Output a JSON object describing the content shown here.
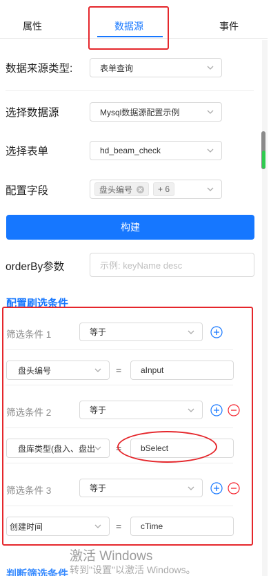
{
  "tabs": [
    {
      "label": "属性"
    },
    {
      "label": "数据源"
    },
    {
      "label": "事件"
    }
  ],
  "form": {
    "data_source_type": {
      "label": "数据来源类型:",
      "value": "表单查询"
    },
    "select_data_source": {
      "label": "选择数据源",
      "value": "Mysql数据源配置示例"
    },
    "select_form": {
      "label": "选择表单",
      "value": "hd_beam_check"
    },
    "config_fields": {
      "label": "配置字段",
      "tag": "盘头编号",
      "more": "+ 6"
    },
    "build_button": "构建",
    "order_by": {
      "label": "orderBy参数",
      "placeholder": "示例: keyName desc"
    }
  },
  "filter": {
    "title": "配置刷选条件",
    "conditions": [
      {
        "label": "筛选条件 1",
        "operator": "等于",
        "field": "盘头编号",
        "value": "aInput",
        "eq": "="
      },
      {
        "label": "筛选条件 2",
        "operator": "等于",
        "field": "盘库类型(盘入、盘出",
        "value": "bSelect",
        "eq": "="
      },
      {
        "label": "筛选条件 3",
        "operator": "等于",
        "field": "创建时间",
        "value": "cTime",
        "eq": "="
      }
    ]
  },
  "watermark": {
    "line1": "激活 Windows",
    "line2": "转到\"设置\"以激活 Windows。"
  },
  "cut_text": "判断筛选条件",
  "colors": {
    "accent": "#1677ff",
    "highlight": "#e5262b",
    "danger": "#f5222d"
  }
}
